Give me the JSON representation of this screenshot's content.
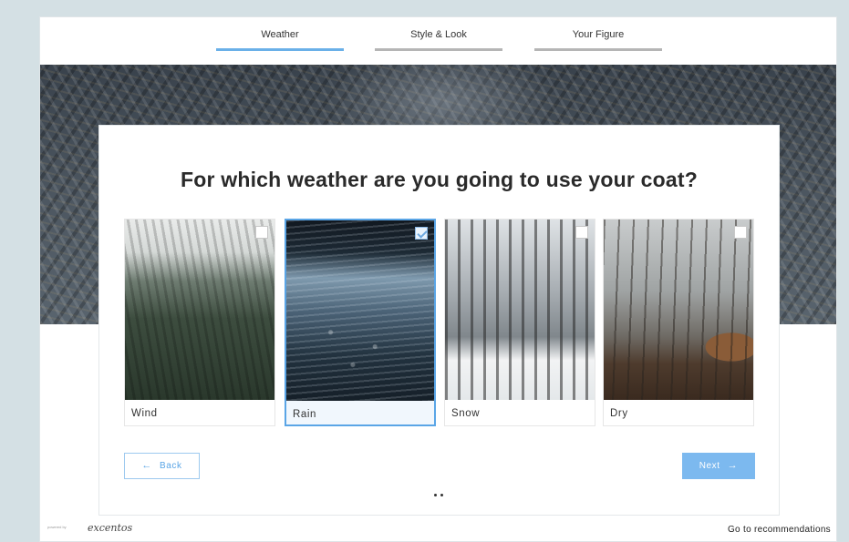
{
  "progress": {
    "steps": [
      {
        "label": "Weather",
        "active": true
      },
      {
        "label": "Style & Look",
        "active": false
      },
      {
        "label": "Your Figure",
        "active": false
      }
    ]
  },
  "question": {
    "title": "For which weather are you going to use your coat?"
  },
  "options": [
    {
      "label": "Wind",
      "selected": false,
      "image": "misty-forest-photo"
    },
    {
      "label": "Rain",
      "selected": true,
      "image": "rain-puddle-photo"
    },
    {
      "label": "Snow",
      "selected": false,
      "image": "snowy-road-photo"
    },
    {
      "label": "Dry",
      "selected": false,
      "image": "autumn-woodpile-photo"
    }
  ],
  "navigation": {
    "back_label": "Back",
    "next_label": "Next",
    "back_icon": "arrow-left-icon",
    "next_icon": "arrow-right-icon"
  },
  "footer": {
    "powered_by": "powered by",
    "logo_text": "excentos",
    "recommendations_label": "Go to recommendations"
  },
  "colors": {
    "accent": "#5aa5e6",
    "next_button": "#7cb9ef",
    "inactive_bar": "#b5b5b5"
  }
}
